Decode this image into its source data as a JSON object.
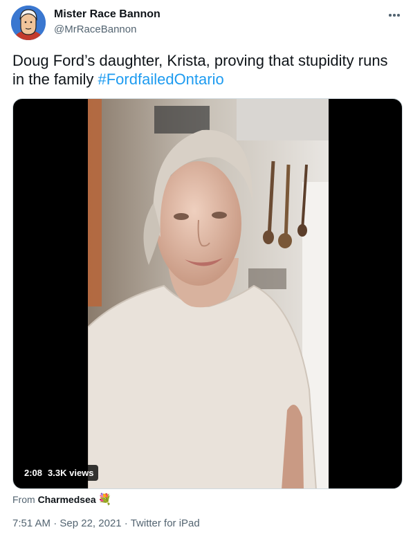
{
  "author": {
    "name": "Mister Race Bannon",
    "handle": "@MrRaceBannon"
  },
  "tweet": {
    "text_before": "Doug Ford’s daughter, Krista, proving that stupidity runs in the family ",
    "hashtag": "#FordfailedOntario"
  },
  "video": {
    "duration": "2:08",
    "views": "3.3K views"
  },
  "source": {
    "prefix": "From ",
    "name": "Charmedsea",
    "emoji": "💐"
  },
  "meta": {
    "time": "7:51 AM",
    "dot1": " · ",
    "date": "Sep 22, 2021",
    "dot2": " · ",
    "client": "Twitter for iPad"
  },
  "colors": {
    "link": "#1d9bf0",
    "secondary_text": "#536471",
    "primary_text": "#0f1419"
  },
  "icons": [
    "avatar",
    "more-options-icon",
    "bouquet-emoji"
  ]
}
